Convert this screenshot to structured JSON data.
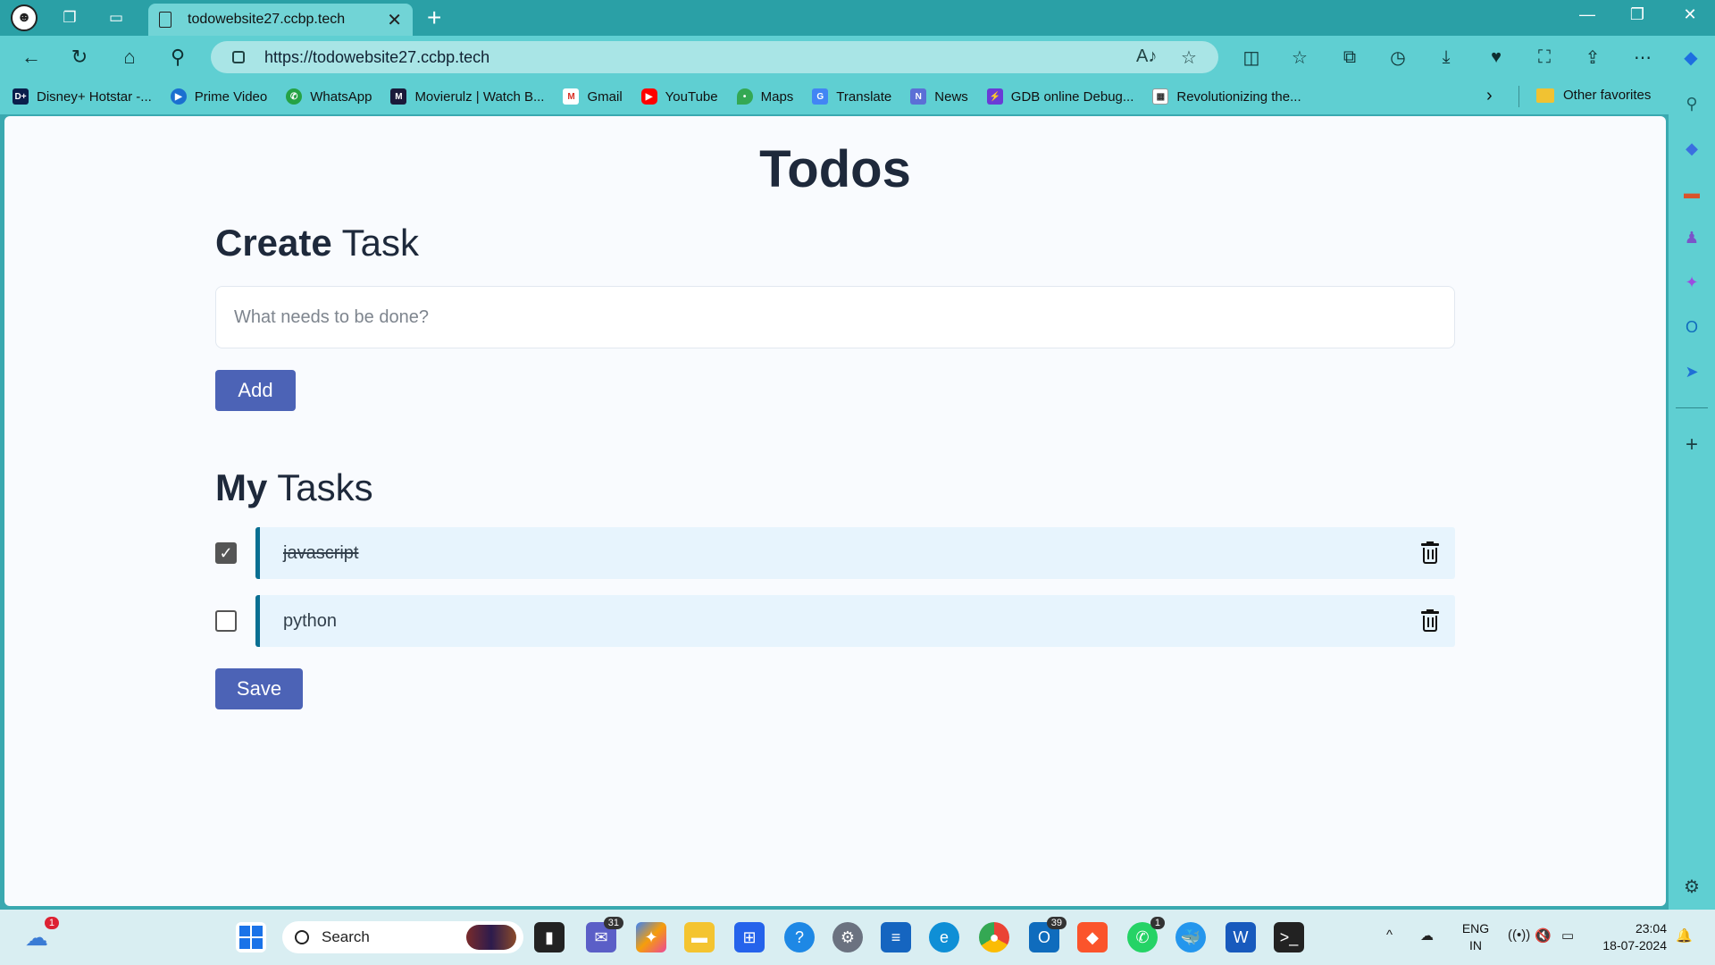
{
  "browser": {
    "tab_title": "todowebsite27.ccbp.tech",
    "url": "https://todowebsite27.ccbp.tech",
    "favorites": [
      {
        "label": "Disney+ Hotstar -...",
        "icon": "hotstar-icon",
        "color": "#0b1f4b"
      },
      {
        "label": "Prime Video",
        "icon": "prime-video-icon",
        "color": "#1a6fd0"
      },
      {
        "label": "WhatsApp",
        "icon": "whatsapp-icon",
        "color": "#25a244"
      },
      {
        "label": "Movierulz | Watch B...",
        "icon": "movierulz-icon",
        "color": "#1a1a3a"
      },
      {
        "label": "Gmail",
        "icon": "gmail-icon",
        "color": "#d93025"
      },
      {
        "label": "YouTube",
        "icon": "youtube-icon",
        "color": "#ff0000"
      },
      {
        "label": "Maps",
        "icon": "maps-icon",
        "color": "#34a853"
      },
      {
        "label": "Translate",
        "icon": "translate-icon",
        "color": "#4285f4"
      },
      {
        "label": "News",
        "icon": "news-icon",
        "color": "#5b6fd6"
      },
      {
        "label": "GDB online Debug...",
        "icon": "gdb-icon",
        "color": "#6a3bd6"
      },
      {
        "label": "Revolutionizing the...",
        "icon": "revolutionizing-icon",
        "color": "#ffffff"
      }
    ],
    "other_favorites": "Other favorites"
  },
  "page": {
    "title": "Todos",
    "create_heading_bold": "Create",
    "create_heading_rest": "Task",
    "input_placeholder": "What needs to be done?",
    "add_label": "Add",
    "tasks_heading_bold": "My",
    "tasks_heading_rest": "Tasks",
    "tasks": [
      {
        "label": "javascript",
        "checked": true
      },
      {
        "label": "python",
        "checked": false
      }
    ],
    "save_label": "Save"
  },
  "taskbar": {
    "search_label": "Search",
    "weather_badge": "1",
    "teams_badge": "31",
    "outlook_badge": "39",
    "whatsapp_badge": "1",
    "lang_line1": "ENG",
    "lang_line2": "IN",
    "time": "23:04",
    "date": "18-07-2024"
  },
  "colors": {
    "accent_button": "#4c63b6",
    "task_bar_left": "#096f92",
    "task_bg": "#e7f4fd",
    "browser_chrome": "#5fcfd2"
  }
}
